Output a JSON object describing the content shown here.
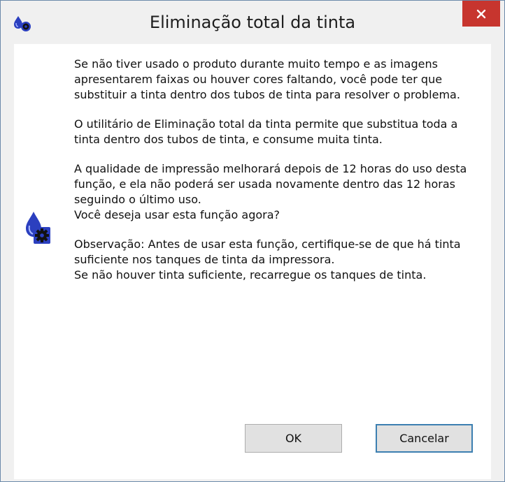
{
  "window": {
    "title": "Eliminação total da tinta",
    "app_icon": "ink-drop-gear-icon",
    "close_icon": "close-icon"
  },
  "dialog": {
    "icon": "ink-drop-gear-icon",
    "paragraphs": [
      "Se não tiver usado o produto durante muito tempo e as imagens\napresentarem faixas ou houver cores faltando, você pode ter que\nsubstituir a tinta dentro dos tubos de tinta para resolver o problema.",
      "O utilitário de Eliminação total da tinta permite que substitua toda a\ntinta dentro dos tubos de tinta, e consume muita tinta.",
      "A qualidade de impressão melhorará depois de 12 horas do uso desta\nfunção, e ela não poderá ser usada novamente dentro das 12 horas\nseguindo o último uso.",
      "Você deseja usar esta função agora?",
      "Observação: Antes de usar esta função, certifique-se de que há tinta\nsuficiente nos tanques de tinta da impressora.",
      "Se não houver tinta suficiente, recarregue os tanques de tinta."
    ],
    "ok_label": "OK",
    "cancel_label": "Cancelar"
  },
  "colors": {
    "close_button": "#c7352e",
    "focus_border": "#3c7fb1",
    "ink_blue": "#2b3fbf"
  }
}
